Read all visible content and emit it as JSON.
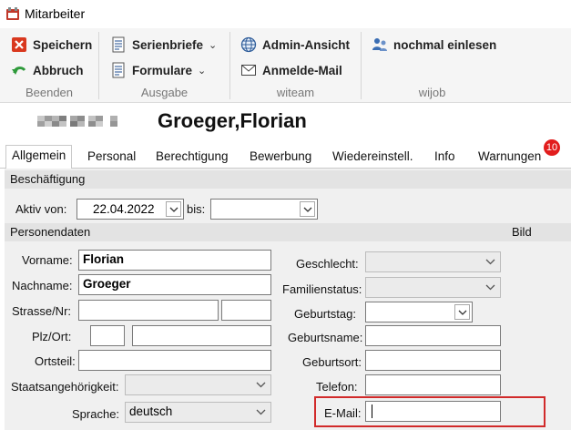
{
  "window": {
    "title": "Mitarbeiter"
  },
  "ribbon": {
    "groups": [
      {
        "label": "Beenden",
        "buttons": [
          "Speichern",
          "Abbruch"
        ]
      },
      {
        "label": "Ausgabe",
        "buttons": [
          "Serienbriefe",
          "Formulare"
        ]
      },
      {
        "label": "witeam",
        "buttons": [
          "Admin-Ansicht",
          "Anmelde-Mail"
        ]
      },
      {
        "label": "wijob",
        "buttons": [
          "nochmal einlesen"
        ]
      }
    ]
  },
  "employee": {
    "name": "Groeger,Florian"
  },
  "tabs": [
    "Allgemein",
    "Personal",
    "Berechtigung",
    "Bewerbung",
    "Wiedereinstell.",
    "Info",
    "Warnungen"
  ],
  "warnings_count": "10",
  "sections": {
    "employment": "Beschäftigung",
    "personal": "Personendaten",
    "picture": "Bild"
  },
  "employment": {
    "active_from_label": "Aktiv von:",
    "active_from_value": "22.04.2022",
    "until_label": "bis:",
    "until_value": ""
  },
  "fields": {
    "vorname": {
      "label": "Vorname:",
      "value": "Florian"
    },
    "nachname": {
      "label": "Nachname:",
      "value": "Groeger"
    },
    "strasse": {
      "label": "Strasse/Nr:",
      "value": "",
      "nr": ""
    },
    "plzort": {
      "label": "Plz/Ort:",
      "plz": "",
      "ort": ""
    },
    "ortsteil": {
      "label": "Ortsteil:",
      "value": ""
    },
    "staat": {
      "label": "Staatsangehörigkeit:",
      "value": ""
    },
    "sprache": {
      "label": "Sprache:",
      "value": "deutsch"
    },
    "geschlecht": {
      "label": "Geschlecht:",
      "value": ""
    },
    "familienstatus": {
      "label": "Familienstatus:",
      "value": ""
    },
    "geburtstag": {
      "label": "Geburtstag:",
      "value": ""
    },
    "geburtsname": {
      "label": "Geburtsname:",
      "value": ""
    },
    "geburtsort": {
      "label": "Geburtsort:",
      "value": ""
    },
    "telefon": {
      "label": "Telefon:",
      "value": ""
    },
    "email": {
      "label": "E-Mail:",
      "value": ""
    }
  },
  "colors": {
    "highlight": "#d12a2a",
    "badge": "#e21d1d",
    "ribbon_bg": "#f5f5f5"
  }
}
